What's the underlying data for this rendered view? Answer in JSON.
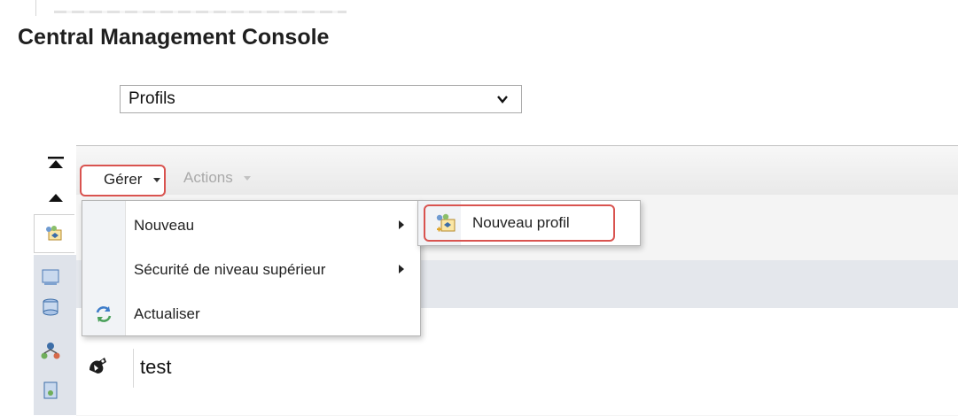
{
  "header": {
    "title": "Central Management Console"
  },
  "selector": {
    "value": "Profils"
  },
  "toolbar": {
    "manage_label": "Gérer",
    "actions_label": "Actions"
  },
  "manage_menu": {
    "items": [
      {
        "label": "Nouveau",
        "has_submenu": true
      },
      {
        "label": "Sécurité de niveau supérieur",
        "has_submenu": true
      },
      {
        "label": "Actualiser",
        "icon": "refresh-icon"
      }
    ]
  },
  "submenu": {
    "item_label": "Nouveau profil",
    "icon": "new-profile-icon"
  },
  "list": {
    "rows": [
      {
        "name": "test",
        "icon": "profile-icon"
      }
    ]
  },
  "colors": {
    "highlight": "#d9534f",
    "toolbar_bg": "#ebebeb",
    "header_band": "#e4e7ec",
    "sidebar_bg": "#dfe3ea"
  }
}
